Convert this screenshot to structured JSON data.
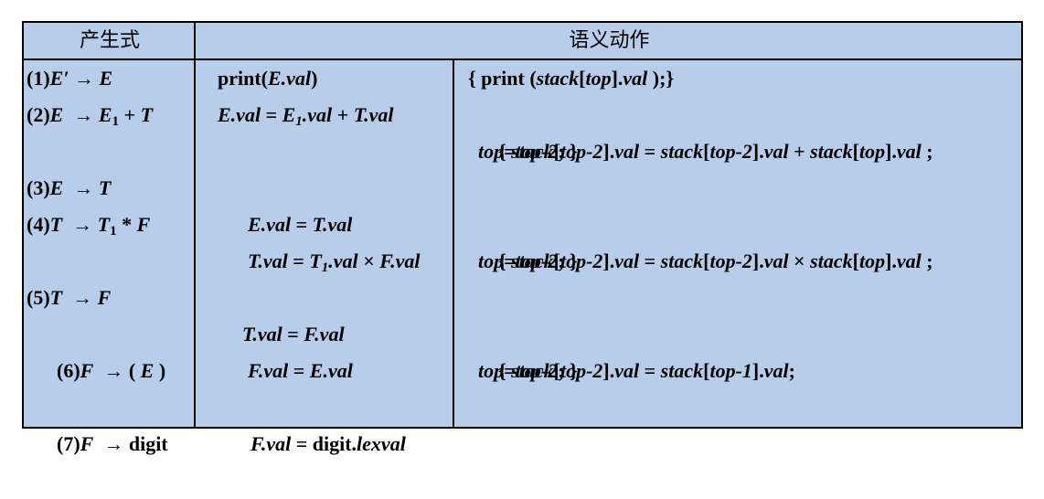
{
  "header": {
    "production": "产生式",
    "semantic_action": "语义动作"
  },
  "rows": [
    {
      "production": [
        "(1)",
        "E′",
        " → ",
        "E"
      ],
      "semantic": [
        "print(",
        "E.val",
        ")"
      ],
      "action_line1": [
        "{ print (",
        "stack",
        "[",
        "top",
        "].",
        "val",
        " );}"
      ]
    },
    {
      "production": [
        "(2)",
        "E",
        "  → ",
        "E",
        "1",
        " + ",
        "T"
      ],
      "semantic": [
        "E.val",
        " = ",
        "E",
        "1",
        ".val",
        " + ",
        "T.val"
      ],
      "action_line1": [
        "{ ",
        "stack",
        "[",
        "top-2",
        "].",
        "val",
        " = ",
        "stack",
        "[",
        "top-2",
        "].",
        "val",
        " + ",
        "stack",
        "[",
        "top",
        "].",
        "val",
        " ;"
      ],
      "action_line2": [
        "top",
        "=",
        "top-2",
        "; }"
      ]
    },
    {
      "production": [
        "(3)",
        "E",
        "  → ",
        "T"
      ],
      "semantic": [
        "E.val",
        " = ",
        "T.val"
      ]
    },
    {
      "production": [
        "(4)",
        "T",
        "  → ",
        "T",
        "1",
        " * ",
        "F"
      ],
      "semantic": [
        "T.val",
        " = ",
        "T",
        "1",
        ".val",
        " × ",
        "F.val"
      ],
      "action_line1": [
        "{ ",
        "stack",
        "[",
        "top-2",
        "].",
        "val",
        " = ",
        "stack",
        "[",
        "top-2",
        "].",
        "val",
        " × ",
        "stack",
        "[",
        "top",
        "].",
        "val",
        " ;"
      ],
      "action_line2": [
        "top",
        "=",
        "top-2",
        "; }"
      ]
    },
    {
      "production": [
        "(5)",
        "T",
        "  → ",
        "F"
      ],
      "semantic": [
        "T.val",
        " = ",
        "F.val"
      ]
    },
    {
      "production": [
        "(6)",
        "F",
        "  → ( ",
        "E",
        " )"
      ],
      "semantic": [
        "F.val",
        " = ",
        "E.val"
      ],
      "action_line1": [
        "{ ",
        "stack",
        "[",
        "top-2",
        "].",
        "val",
        " = ",
        "stack",
        "[",
        "top-1",
        "].",
        "val",
        ";"
      ],
      "action_line2": [
        "top",
        "=",
        "top-2",
        "; }"
      ]
    },
    {
      "production": [
        "(7)",
        "F",
        "  → digit"
      ],
      "semantic": [
        "F.val",
        " = digit.",
        "lexval"
      ]
    }
  ]
}
